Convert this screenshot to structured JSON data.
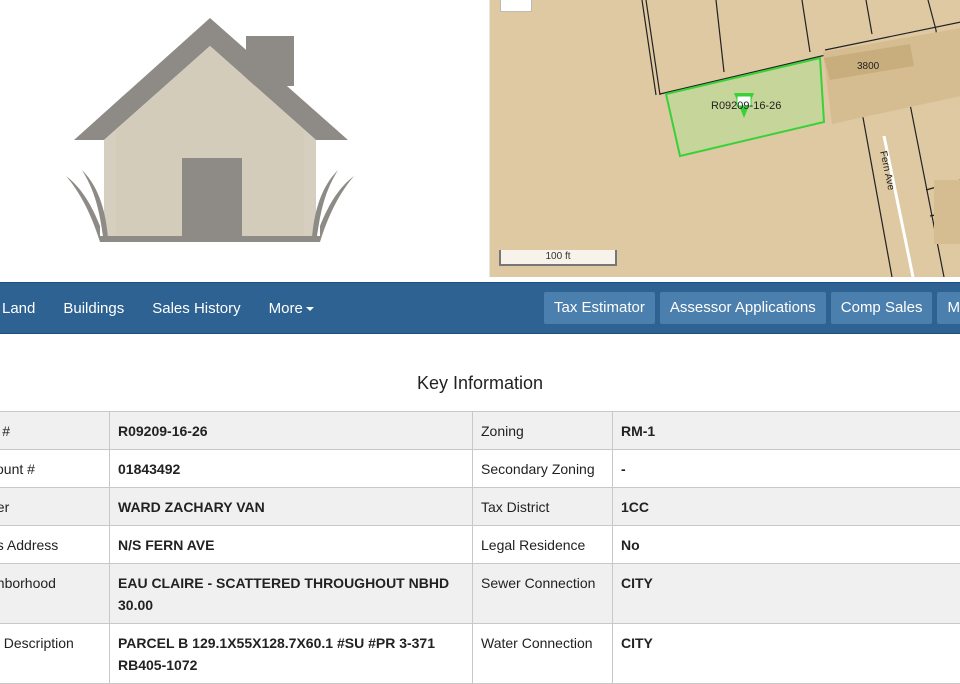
{
  "hero": {
    "house_icon": "house-icon",
    "map": {
      "parcel_label": "R09209-16-26",
      "lot_label": "3800",
      "street_label": "Fern Ave",
      "scale_label": "100 ft",
      "colors": {
        "ground": "#dfc9a2",
        "parcel_fill": "#c6d59a",
        "parcel_stroke": "#39d13a"
      }
    }
  },
  "nav": {
    "left": [
      "Land",
      "Buildings",
      "Sales History",
      "More"
    ],
    "right": [
      "Tax Estimator",
      "Assessor Applications",
      "Comp Sales",
      "Mo"
    ],
    "colors": {
      "bar": "#2d6292",
      "button": "#4b7fae"
    }
  },
  "key_info": {
    "title": "Key Information",
    "rows": [
      {
        "label1": "S #",
        "value1": "R09209-16-26",
        "label2": "Zoning",
        "value2": "RM-1"
      },
      {
        "label1": "count #",
        "value1": "01843492",
        "label2": "Secondary Zoning",
        "value2": "-"
      },
      {
        "label1": "ner",
        "value1": "WARD ZACHARY VAN",
        "label2": "Tax District",
        "value2": "1CC"
      },
      {
        "label1": "us Address",
        "value1": "N/S FERN AVE",
        "label2": "Legal Residence",
        "value2": "No"
      },
      {
        "label1": "ghborhood",
        "value1": "EAU CLAIRE - SCATTERED THROUGHOUT NBHD 30.00",
        "label2": "Sewer Connection",
        "value2": "CITY"
      },
      {
        "label1": "al Description",
        "value1": "PARCEL B 129.1X55X128.7X60.1 #SU #PR 3-371 RB405-1072",
        "label2": "Water Connection",
        "value2": "CITY"
      }
    ]
  }
}
